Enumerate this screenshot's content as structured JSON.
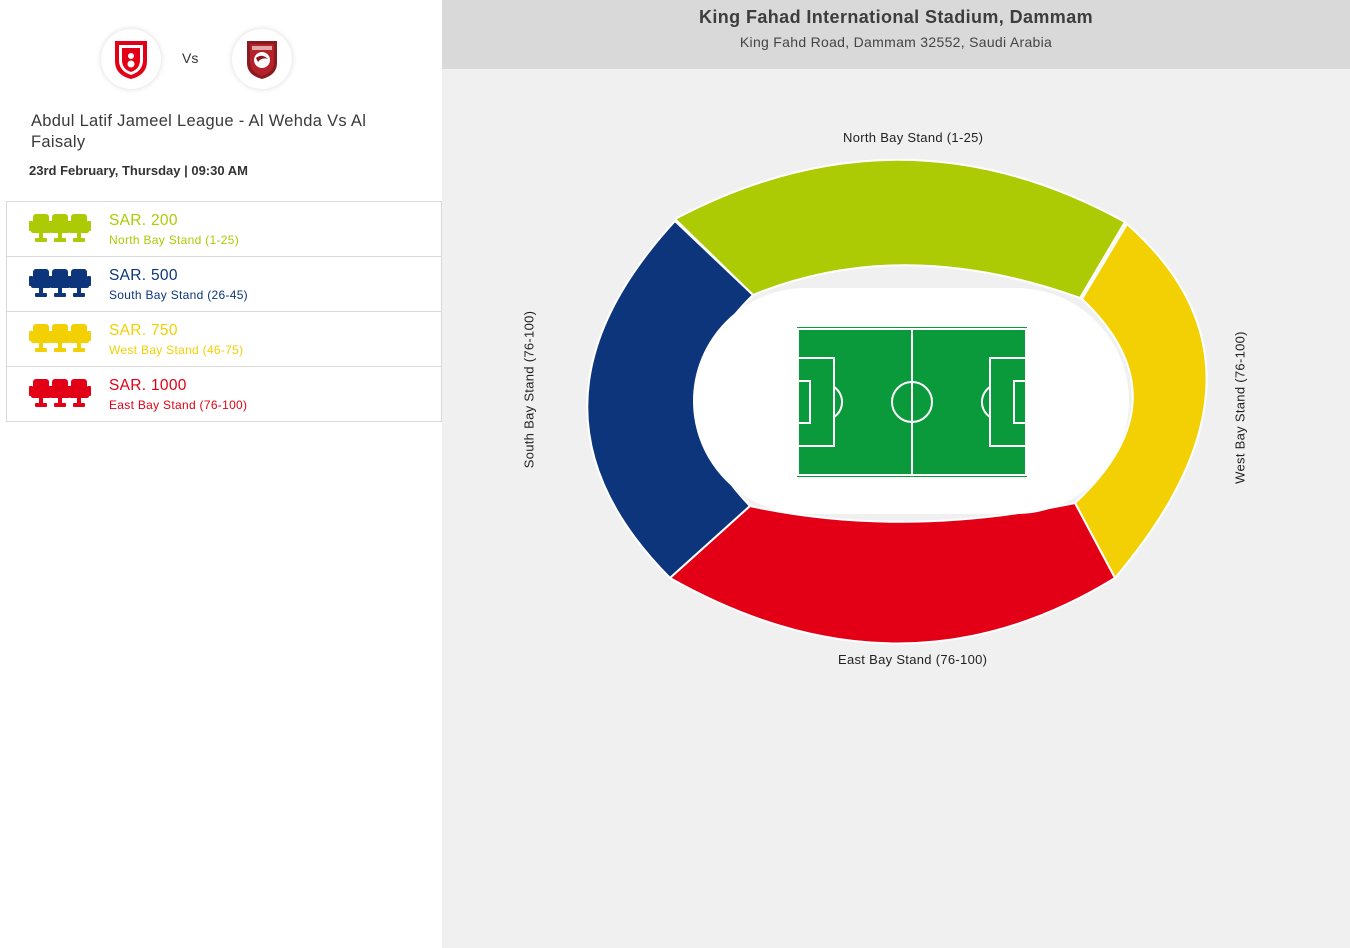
{
  "match": {
    "home_logo": "al-wehda-crest",
    "away_logo": "al-faisaly-crest",
    "vs_label": "Vs",
    "title": "Abdul Latif Jameel League - Al Wehda Vs Al Faisaly",
    "date_time": "23rd February, Thursday | 09:30 AM"
  },
  "prices": [
    {
      "amount": "SAR. 200",
      "stand": "North Bay Stand (1-25)",
      "color": "#adcb05",
      "icon": "seats-icon"
    },
    {
      "amount": "SAR. 500",
      "stand": "South Bay Stand (26-45)",
      "color": "#0c357c",
      "icon": "seats-icon"
    },
    {
      "amount": "SAR. 750",
      "stand": "West Bay Stand (46-75)",
      "color": "#f2d003",
      "icon": "seats-icon"
    },
    {
      "amount": "SAR. 1000",
      "stand": "East Bay Stand (76-100)",
      "color": "#e30016",
      "icon": "seats-icon"
    }
  ],
  "venue": {
    "name": "King Fahad International Stadium, Dammam",
    "address": "King Fahd Road, Dammam 32552, Saudi Arabia"
  },
  "stands": {
    "north": {
      "label": "North Bay Stand (1-25)",
      "color": "#adcb05"
    },
    "south": {
      "label": "South Bay Stand (76-100)",
      "color": "#0c357c"
    },
    "west": {
      "label": "West Bay Stand (76-100)",
      "color": "#f2d003"
    },
    "east": {
      "label": "East Bay Stand (76-100)",
      "color": "#e30016"
    }
  },
  "pitch": {
    "color": "#0a9a3c"
  }
}
